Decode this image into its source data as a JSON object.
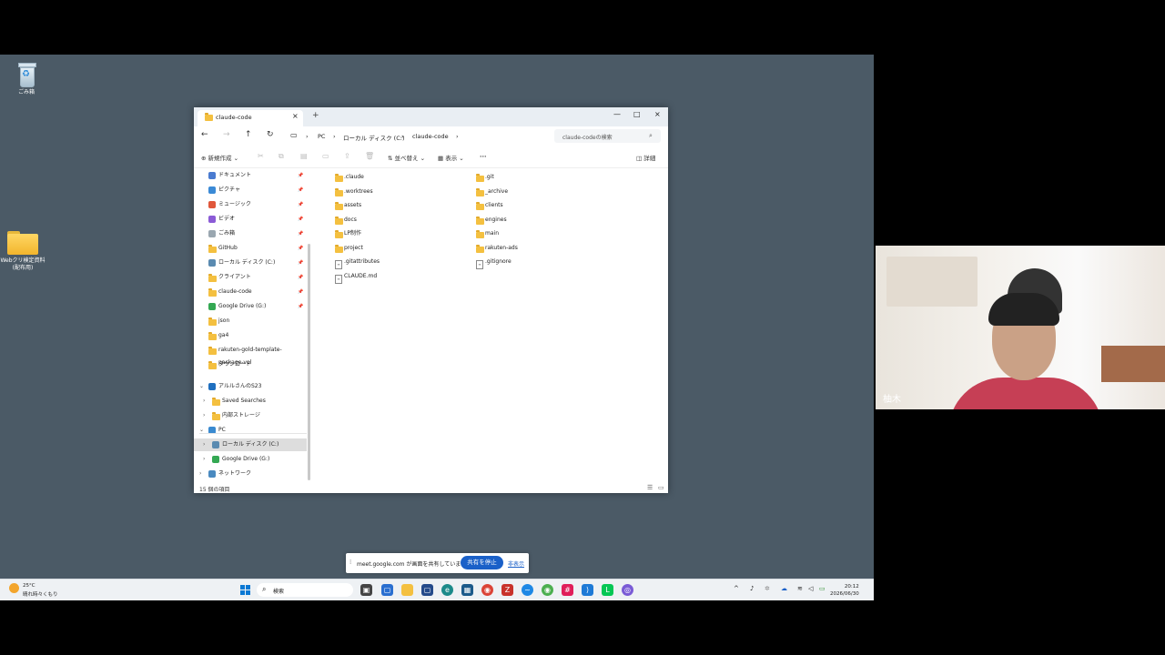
{
  "desktop": {
    "recycle_label": "ごみ箱",
    "folder_label": "Webクリ検定資料(配布用)"
  },
  "explorer": {
    "tab_title": "claude-code",
    "tab_close": "×",
    "tab_add": "+",
    "window_controls": [
      "—",
      "□",
      "×"
    ],
    "nav": {
      "back": "←",
      "forward": "→",
      "up": "↑",
      "refresh": "↻"
    },
    "breadcrumbs": [
      "PC",
      "ローカル ディスク (C:)",
      "claude-code"
    ],
    "search_placeholder": "claude-codeの検索",
    "toolbar": {
      "new": "新規作成",
      "sort": "並べ替え",
      "view": "表示",
      "more": "···",
      "details": "詳細"
    },
    "sidebar_pinned": [
      {
        "label": "ドキュメント",
        "icon": "documents-icon",
        "color": "#4a7bd0"
      },
      {
        "label": "ピクチャ",
        "icon": "pictures-icon",
        "color": "#3b8ad6"
      },
      {
        "label": "ミュージック",
        "icon": "music-icon",
        "color": "#e0573b"
      },
      {
        "label": "ビデオ",
        "icon": "videos-icon",
        "color": "#8b5bd6"
      },
      {
        "label": "ごみ箱",
        "icon": "recycle-bin-icon",
        "color": "#9aa7b0"
      },
      {
        "label": "GitHub",
        "icon": "folder-icon",
        "color": "#f4c040"
      },
      {
        "label": "ローカル ディスク (C:)",
        "icon": "drive-icon",
        "color": "#5a8ab0"
      },
      {
        "label": "クライアント",
        "icon": "folder-icon",
        "color": "#f4c040"
      },
      {
        "label": "claude-code",
        "icon": "folder-icon",
        "color": "#f4c040"
      },
      {
        "label": "Google Drive (G:)",
        "icon": "google-drive-icon",
        "color": "#34a853"
      },
      {
        "label": "json",
        "icon": "folder-icon",
        "color": "#f4c040"
      },
      {
        "label": "ga4",
        "icon": "folder-icon",
        "color": "#f4c040"
      },
      {
        "label": "rakuten-gold-template-package-vol",
        "icon": "folder-icon",
        "color": "#f4c040"
      },
      {
        "label": "ダウンロード",
        "icon": "folder-icon",
        "color": "#f4c040"
      }
    ],
    "sidebar_tree": [
      {
        "label": "アルルさんのS23",
        "icon": "phone-icon",
        "chev": "⌄",
        "indent": 0
      },
      {
        "label": "Saved Searches",
        "icon": "folder-icon",
        "chev": "›",
        "indent": 1
      },
      {
        "label": "内部ストレージ",
        "icon": "folder-icon",
        "chev": "›",
        "indent": 1
      },
      {
        "label": "PC",
        "icon": "pc-icon",
        "chev": "⌄",
        "indent": 0
      },
      {
        "label": "ローカル ディスク (C:)",
        "icon": "drive-icon",
        "chev": "›",
        "indent": 1,
        "selected": true
      },
      {
        "label": "Google Drive (G:)",
        "icon": "google-drive-icon",
        "chev": "›",
        "indent": 1
      },
      {
        "label": "ネットワーク",
        "icon": "network-icon",
        "chev": "›",
        "indent": 0
      }
    ],
    "files_col1": [
      {
        "name": ".claude",
        "type": "folder"
      },
      {
        "name": ".worktrees",
        "type": "folder"
      },
      {
        "name": "assets",
        "type": "folder"
      },
      {
        "name": "docs",
        "type": "folder"
      },
      {
        "name": "LP制作",
        "type": "folder"
      },
      {
        "name": "project",
        "type": "folder"
      },
      {
        "name": ".gitattributes",
        "type": "file"
      },
      {
        "name": "CLAUDE.md",
        "type": "file"
      }
    ],
    "files_col2": [
      {
        "name": ".git",
        "type": "folder"
      },
      {
        "name": "_archive",
        "type": "folder"
      },
      {
        "name": "clients",
        "type": "folder"
      },
      {
        "name": "engines",
        "type": "folder"
      },
      {
        "name": "main",
        "type": "folder"
      },
      {
        "name": "rakuten-ads",
        "type": "folder"
      },
      {
        "name": ".gitignore",
        "type": "file"
      }
    ],
    "status": "15 個の項目"
  },
  "sharebar": {
    "message": "meet.google.com が画面を共有しています。",
    "stop_label": "共有を停止",
    "hide_label": "非表示"
  },
  "taskbar": {
    "weather_temp": "25°C",
    "weather_desc": "晴れ時々くもり",
    "search_label": "検索",
    "time": "20:12",
    "date": "2026/06/30"
  },
  "video": {
    "participant_name": "柚木"
  }
}
